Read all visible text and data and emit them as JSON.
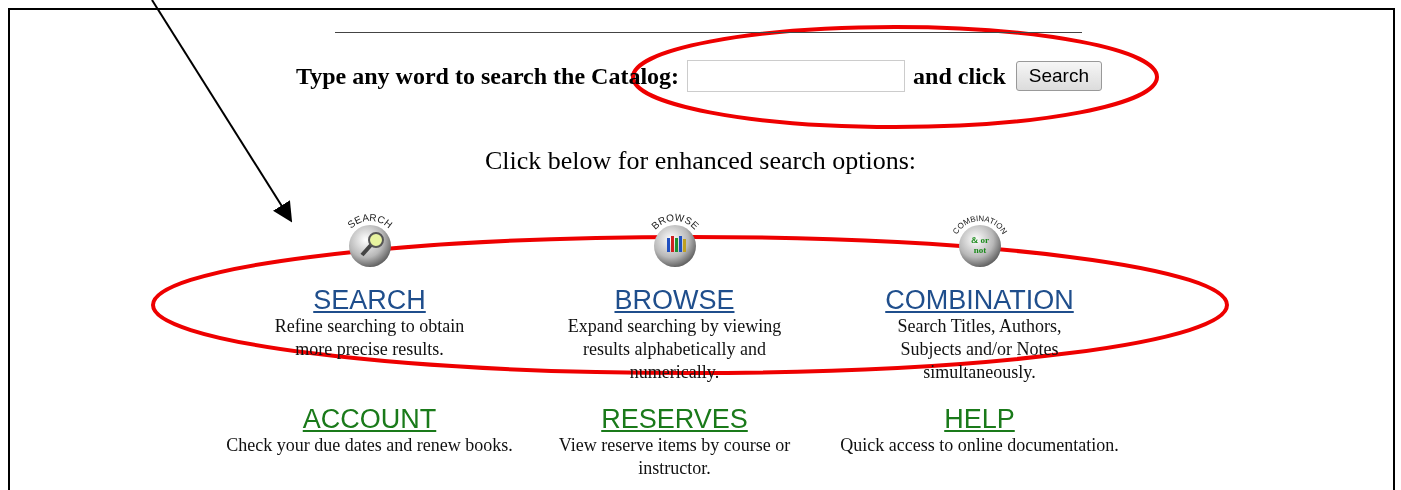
{
  "search_bar": {
    "prompt": "Type any word to search the Catalog:",
    "suffix": "and click",
    "button": "Search"
  },
  "heading": "Click below for enhanced search options:",
  "options": [
    {
      "label": "SEARCH",
      "color": "#1f4e8c",
      "icon": {
        "kind": "magnifier",
        "caption": "SEARCH"
      },
      "lines": [
        "Refine searching to obtain",
        "more precise results."
      ]
    },
    {
      "label": "BROWSE",
      "color": "#1f4e8c",
      "icon": {
        "kind": "books",
        "caption": "BROWSE"
      },
      "lines": [
        "Expand searching by viewing",
        "results alphabetically and",
        "numerically."
      ]
    },
    {
      "label": "COMBINATION",
      "color": "#1f4e8c",
      "icon": {
        "kind": "words",
        "caption": "COMBINATION",
        "inner": [
          "& or",
          "not"
        ]
      },
      "lines": [
        "Search Titles, Authors,",
        "Subjects and/or Notes",
        "simultaneously."
      ]
    },
    {
      "label": "ACCOUNT",
      "color": "#1a7a1a",
      "lines": [
        "Check your due dates and renew books."
      ]
    },
    {
      "label": "RESERVES",
      "color": "#1a7a1a",
      "lines": [
        "View reserve items by course or",
        "instructor."
      ]
    },
    {
      "label": "HELP",
      "color": "#1a7a1a",
      "lines": [
        "Quick access to online documentation."
      ]
    }
  ],
  "annotations": [
    {
      "kind": "arrow"
    },
    {
      "kind": "ellipse"
    },
    {
      "kind": "ellipse"
    }
  ]
}
